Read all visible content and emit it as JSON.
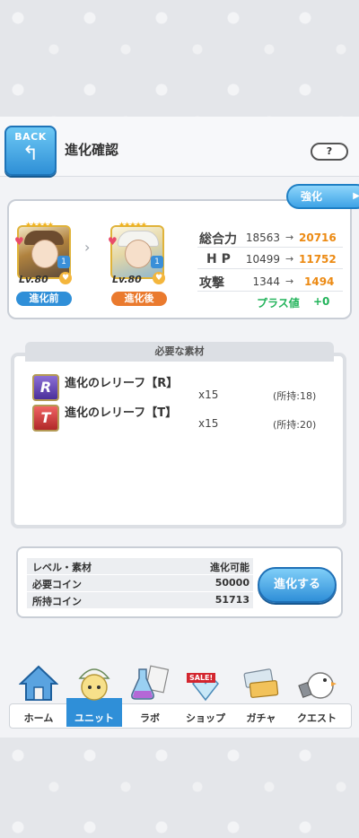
{
  "header": {
    "back_label": "BACK",
    "back_icon": "↰",
    "title": "進化確認",
    "help_label": "?"
  },
  "enhance_button": {
    "label": "強化",
    "icon": "▶"
  },
  "stats": {
    "before": {
      "level": "Lv.80",
      "tag": "進化前",
      "rank": "1",
      "stars": "★★★★★"
    },
    "after": {
      "level": "Lv.80",
      "tag": "進化後",
      "rank": "1",
      "stars": "★★★★★"
    },
    "rows": [
      {
        "label": "総合力",
        "from": "18563",
        "arrow": "→",
        "to": "20716"
      },
      {
        "label": "H P",
        "from": "10499",
        "arrow": "→",
        "to": "11752"
      },
      {
        "label": "攻撃",
        "from": "1344",
        "arrow": "→",
        "to": "1494"
      }
    ],
    "plus_label": "プラス値",
    "plus_value": "+0"
  },
  "materials": {
    "header": "必要な素材",
    "items": [
      {
        "icon_letter": "R",
        "name": "進化のレリーフ【R】",
        "qty": "x15",
        "owned": "(所持:18)"
      },
      {
        "icon_letter": "T",
        "name": "進化のレリーフ【T】",
        "qty": "x15",
        "owned": "(所持:20)"
      }
    ]
  },
  "cost": {
    "rows": [
      {
        "key": "レベル・素材",
        "value": "進化可能"
      },
      {
        "key": "必要コイン",
        "value": "50000"
      },
      {
        "key": "所持コイン",
        "value": "51713"
      }
    ],
    "evolve_label": "進化する"
  },
  "nav": {
    "items": [
      {
        "label": "ホーム",
        "icon": "home-icon"
      },
      {
        "label": "ユニット",
        "icon": "unit-icon",
        "active": true
      },
      {
        "label": "ラボ",
        "icon": "lab-icon"
      },
      {
        "label": "ショップ",
        "icon": "shop-icon",
        "badge": "SALE!"
      },
      {
        "label": "ガチャ",
        "icon": "gacha-icon"
      },
      {
        "label": "クエスト",
        "icon": "quest-icon"
      }
    ]
  },
  "colors": {
    "accent_blue": "#2f8fd8",
    "accent_orange": "#ea7a2e",
    "stat_increase": "#ec8a13",
    "plus_green": "#22b35a"
  }
}
